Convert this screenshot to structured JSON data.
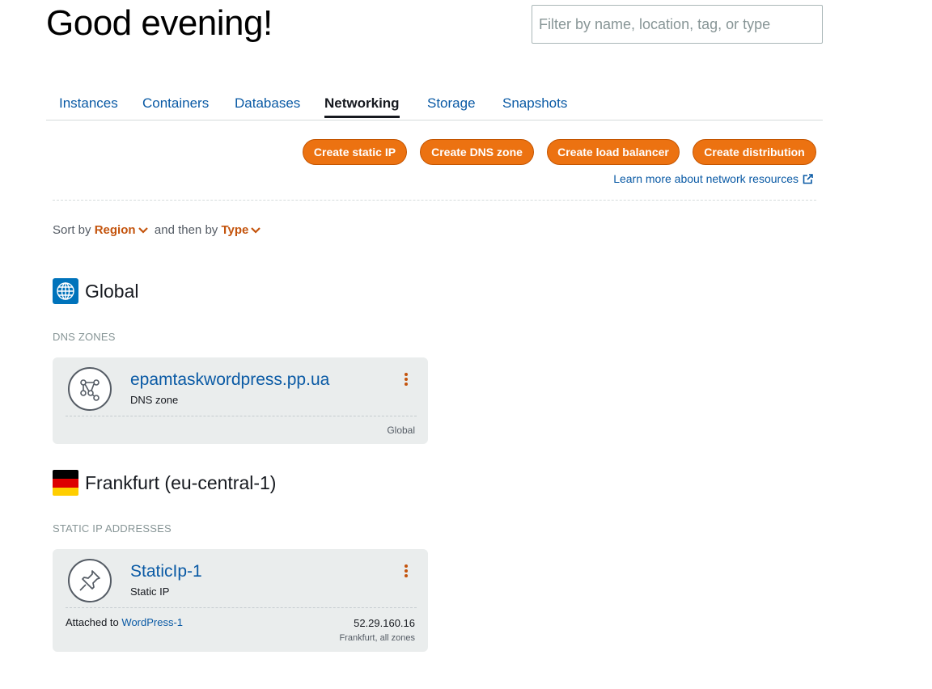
{
  "header": {
    "greeting": "Good evening!",
    "search_placeholder": "Filter by name, location, tag, or type"
  },
  "tabs": [
    {
      "label": "Instances"
    },
    {
      "label": "Containers"
    },
    {
      "label": "Databases"
    },
    {
      "label": "Networking",
      "active": true
    },
    {
      "label": "Storage"
    },
    {
      "label": "Snapshots"
    }
  ],
  "actions": {
    "create_static_ip": "Create static IP",
    "create_dns_zone": "Create DNS zone",
    "create_load_balancer": "Create load balancer",
    "create_distribution": "Create distribution",
    "learn_more": "Learn more about network resources"
  },
  "sort": {
    "prefix": "Sort by",
    "first": "Region",
    "middle": "and then by",
    "second": "Type"
  },
  "regions": [
    {
      "title": "Global",
      "icon": "globe-icon",
      "section_label": "DNS ZONES",
      "resource": {
        "name": "epamtaskwordpress.pp.ua",
        "type": "DNS zone",
        "icon": "dns-zone-icon",
        "location": "Global"
      }
    },
    {
      "title": "Frankfurt (eu-central-1)",
      "icon": "germany-flag-icon",
      "section_label": "STATIC IP ADDRESSES",
      "resource": {
        "name": "StaticIp-1",
        "type": "Static IP",
        "icon": "pushpin-icon",
        "attached_prefix": "Attached to",
        "attached_to": "WordPress-1",
        "ip": "52.29.160.16",
        "location": "Frankfurt, all zones"
      }
    }
  ],
  "colors": {
    "accent": "#ec7211",
    "link": "#0a5aa5",
    "card_bg": "#eaeded",
    "globe_bg": "#0073bb"
  }
}
